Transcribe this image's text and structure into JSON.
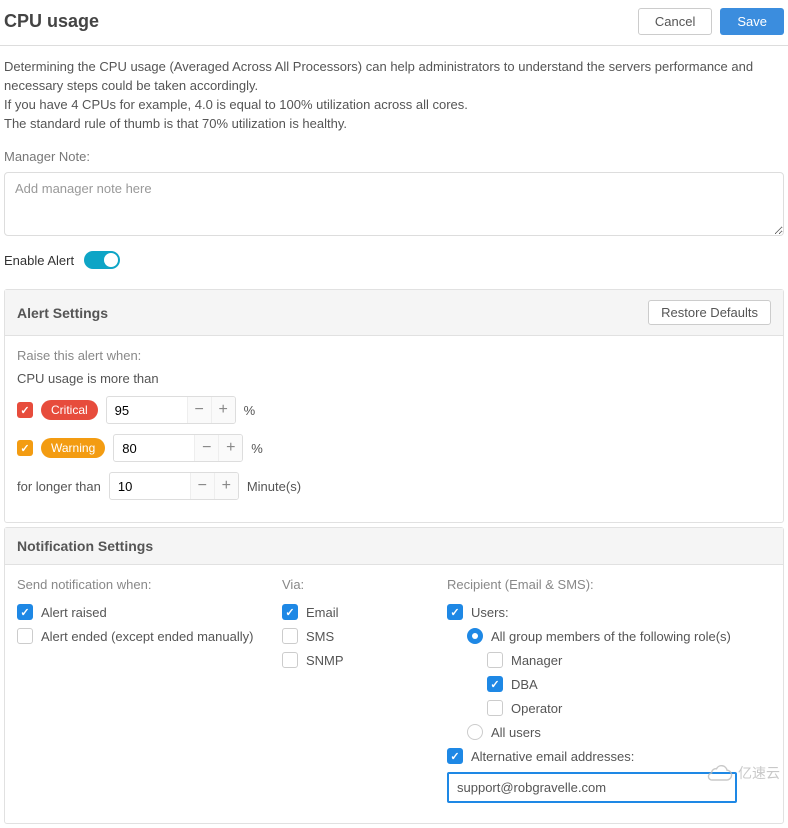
{
  "header": {
    "title": "CPU usage",
    "cancel_label": "Cancel",
    "save_label": "Save"
  },
  "description": {
    "line1": "Determining the CPU usage (Averaged Across All Processors) can help administrators to understand the servers performance and necessary steps could be taken accordingly.",
    "line2": "If you have 4 CPUs for example, 4.0 is equal to 100% utilization across all cores.",
    "line3": "The standard rule of thumb is that 70% utilization is healthy."
  },
  "manager_note": {
    "label": "Manager Note:",
    "placeholder": "Add manager note here",
    "value": ""
  },
  "enable_alert": {
    "label": "Enable Alert",
    "value": true
  },
  "alert_settings": {
    "title": "Alert Settings",
    "restore_label": "Restore Defaults",
    "raise_label": "Raise this alert when:",
    "condition_label": "CPU usage is more than",
    "critical": {
      "enabled": true,
      "label": "Critical",
      "value": "95",
      "unit": "%"
    },
    "warning": {
      "enabled": true,
      "label": "Warning",
      "value": "80",
      "unit": "%"
    },
    "duration": {
      "prefix": "for longer than",
      "value": "10",
      "unit": "Minute(s)"
    }
  },
  "notification_settings": {
    "title": "Notification Settings",
    "when": {
      "title": "Send notification when:",
      "alert_raised": {
        "label": "Alert raised",
        "checked": true
      },
      "alert_ended": {
        "label": "Alert ended (except ended manually)",
        "checked": false
      }
    },
    "via": {
      "title": "Via:",
      "email": {
        "label": "Email",
        "checked": true
      },
      "sms": {
        "label": "SMS",
        "checked": false
      },
      "snmp": {
        "label": "SNMP",
        "checked": false
      }
    },
    "recipient": {
      "title": "Recipient (Email & SMS):",
      "users": {
        "label": "Users:",
        "checked": true
      },
      "group_members_label": "All group members of the following role(s)",
      "group_selected": true,
      "roles": {
        "manager": {
          "label": "Manager",
          "checked": false
        },
        "dba": {
          "label": "DBA",
          "checked": true
        },
        "operator": {
          "label": "Operator",
          "checked": false
        }
      },
      "all_users_label": "All users",
      "all_users_selected": false,
      "alt_email": {
        "label": "Alternative email addresses:",
        "checked": true,
        "value": "support@robgravelle.com"
      }
    }
  },
  "colors": {
    "primary": "#1e88e5",
    "critical": "#e74c3c",
    "warning": "#f39c12",
    "toggle": "#0ea5c6"
  },
  "watermark": "亿速云"
}
